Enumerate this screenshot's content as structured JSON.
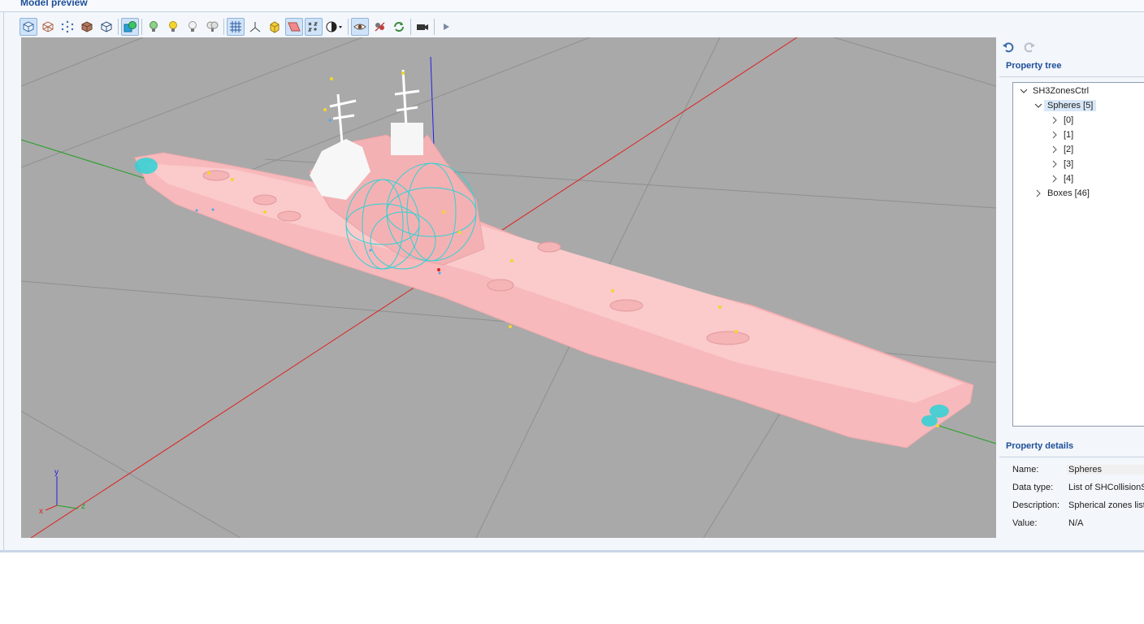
{
  "panel": {
    "title": "Model preview"
  },
  "toolbar": {
    "buttons": [
      {
        "name": "solid-view-icon"
      },
      {
        "name": "wireframe-view-icon"
      },
      {
        "name": "points-view-icon"
      },
      {
        "name": "textured-view-icon"
      },
      {
        "name": "bounding-box-icon"
      },
      {
        "name": "collision-spheres-icon"
      },
      {
        "name": "light-1-icon"
      },
      {
        "name": "light-2-icon"
      },
      {
        "name": "light-3-icon"
      },
      {
        "name": "lights-all-icon"
      },
      {
        "name": "grid-icon"
      },
      {
        "name": "axes-icon"
      },
      {
        "name": "cube-icon"
      },
      {
        "name": "plane-icon"
      },
      {
        "name": "xyz-labels-icon"
      },
      {
        "name": "shading-dropdown-icon"
      },
      {
        "name": "eye-icon"
      },
      {
        "name": "hide-icon"
      },
      {
        "name": "refresh-icon"
      },
      {
        "name": "camera-icon"
      },
      {
        "name": "play-icon"
      }
    ]
  },
  "viewport": {
    "axis_labels": {
      "x": "x",
      "y": "y",
      "z": "z"
    }
  },
  "property_tree": {
    "title": "Property tree",
    "root": "SH3ZonesCtrl",
    "spheres": "Spheres [5]",
    "sphere_items": [
      "[0]",
      "[1]",
      "[2]",
      "[3]",
      "[4]"
    ],
    "boxes": "Boxes [46]"
  },
  "property_details": {
    "title": "Property details",
    "name_label": "Name:",
    "name_value": "Spheres",
    "type_label": "Data type:",
    "type_value": "List of SHCollisionSphere",
    "desc_label": "Description:",
    "desc_value": "Spherical zones list",
    "value_label": "Value:",
    "value_value": "N/A"
  },
  "colors": {
    "accent": "#1c4f9a",
    "viewport_bg": "#a9a9a9",
    "hull": "#f7b9bb",
    "wire": "#2ed2d6"
  }
}
